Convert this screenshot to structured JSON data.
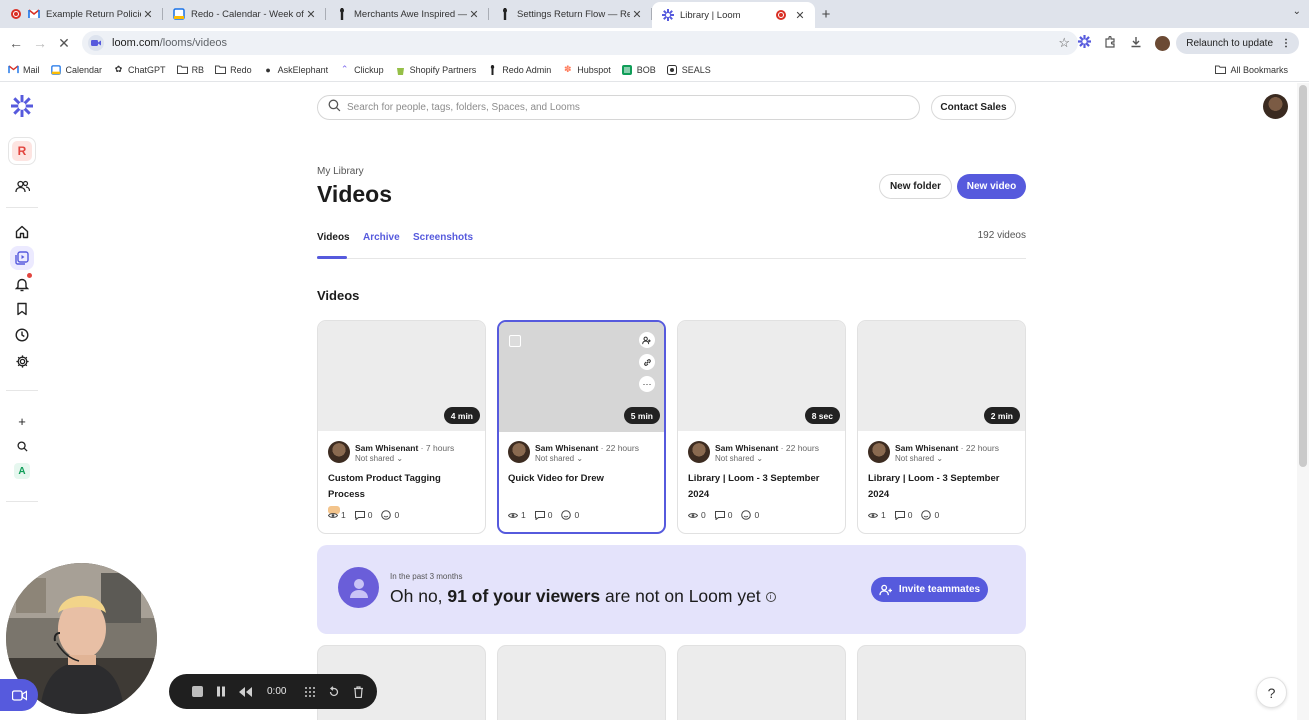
{
  "browser": {
    "tabs": [
      {
        "title": "Example Return Policies - sam",
        "favicon": "gmail-icon",
        "recording": true
      },
      {
        "title": "Redo - Calendar - Week of Se",
        "favicon": "calendar-icon"
      },
      {
        "title": "Merchants Awe Inspired — Re",
        "favicon": "redo-icon"
      },
      {
        "title": "Settings Return Flow — Redo",
        "favicon": "redo-icon"
      },
      {
        "title": "Library | Loom",
        "favicon": "loom-icon",
        "active": true,
        "recording": true
      }
    ],
    "close_glyph": "✕",
    "new_tab_glyph": "+",
    "url_host": "loom.com",
    "url_path": "/looms/videos",
    "relaunch_label": "Relaunch to update",
    "bookmarks": [
      {
        "label": "Mail",
        "icon": "gmail-icon"
      },
      {
        "label": "Calendar",
        "icon": "calendar-icon"
      },
      {
        "label": "ChatGPT",
        "icon": "chatgpt-icon"
      },
      {
        "label": "RB",
        "icon": "folder-icon"
      },
      {
        "label": "Redo",
        "icon": "folder-icon"
      },
      {
        "label": "AskElephant",
        "icon": "elephant-icon"
      },
      {
        "label": "Clickup",
        "icon": "clickup-icon"
      },
      {
        "label": "Shopify Partners",
        "icon": "shopify-icon"
      },
      {
        "label": "Redo Admin",
        "icon": "redo-icon"
      },
      {
        "label": "Hubspot",
        "icon": "hubspot-icon"
      },
      {
        "label": "BOB",
        "icon": "bob-icon"
      },
      {
        "label": "SEALS",
        "icon": "seals-icon"
      }
    ],
    "all_bookmarks_label": "All Bookmarks"
  },
  "rail": {
    "workspace_initial": "R",
    "footer_initial": "A"
  },
  "header": {
    "search_placeholder": "Search for people, tags, folders, Spaces, and Looms",
    "contact_sales_label": "Contact Sales"
  },
  "page": {
    "breadcrumb": "My Library",
    "title": "Videos",
    "new_folder_label": "New folder",
    "new_video_label": "New video",
    "tabs": [
      "Videos",
      "Archive",
      "Screenshots"
    ],
    "video_count": "192 videos",
    "section_title": "Videos"
  },
  "videos": [
    {
      "duration": "4 min",
      "owner": "Sam Whisenant",
      "time": "7 hours",
      "share": "Not shared",
      "title": "Custom Product Tagging Process",
      "views": "1",
      "comments": "0",
      "reactions": "0",
      "emoji": "hand-emoji"
    },
    {
      "duration": "5 min",
      "owner": "Sam Whisenant",
      "time": "22 hours",
      "share": "Not shared",
      "title": "Quick Video for Drew",
      "views": "1",
      "comments": "0",
      "reactions": "0",
      "selected": true
    },
    {
      "duration": "8 sec",
      "owner": "Sam Whisenant",
      "time": "22 hours",
      "share": "Not shared",
      "title": "Library | Loom - 3 September 2024",
      "views": "0",
      "comments": "0",
      "reactions": "0"
    },
    {
      "duration": "2 min",
      "owner": "Sam Whisenant",
      "time": "22 hours",
      "share": "Not shared",
      "title": "Library | Loom - 3 September 2024",
      "views": "1",
      "comments": "0",
      "reactions": "0"
    }
  ],
  "separator": "·",
  "banner": {
    "small": "In the past 3 months",
    "pre": "Oh no,",
    "bold": "91 of your viewers",
    "post": "are not on Loom yet",
    "button": "Invite teammates"
  },
  "recorder": {
    "time": "0:00"
  },
  "help_label": "?",
  "colors": {
    "accent": "#565add",
    "banner_bg": "#e4e3fb",
    "recording_red": "#d93025"
  }
}
